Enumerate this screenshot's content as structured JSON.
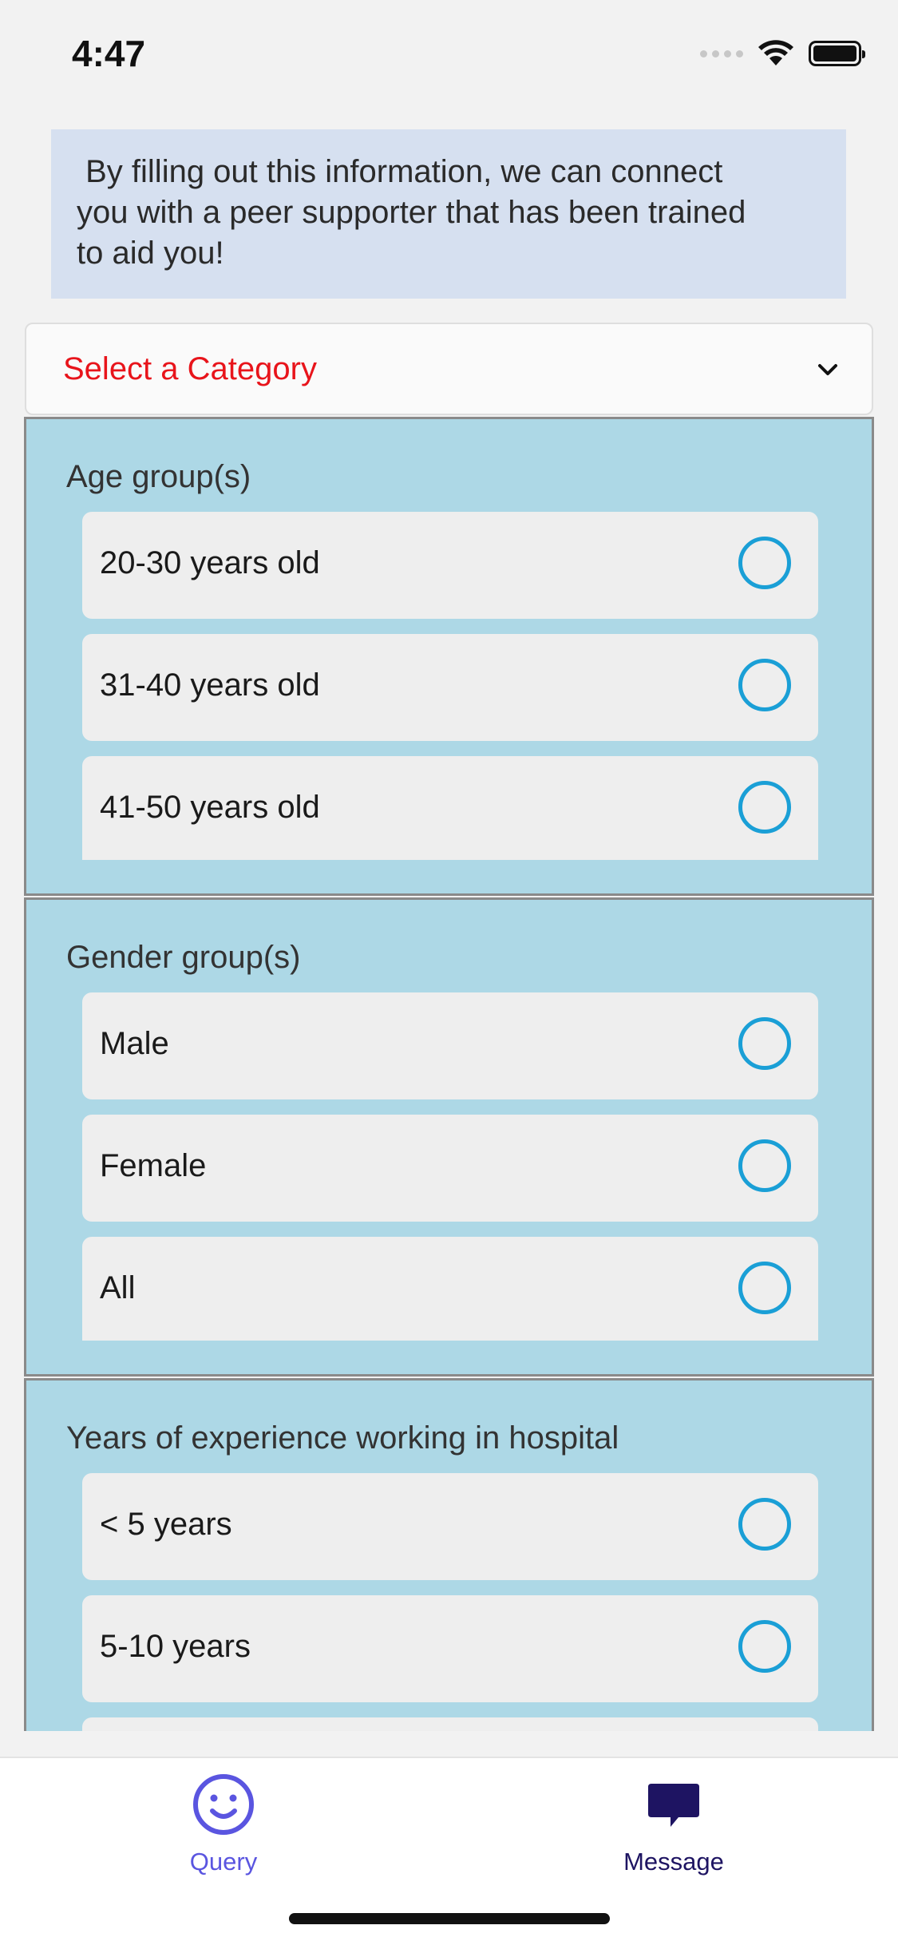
{
  "status_bar": {
    "time": "4:47"
  },
  "info_banner": {
    "text": " By filling out this information, we can connect\nyou with a peer supporter that has been trained\nto aid you!"
  },
  "category_select": {
    "placeholder": "Select a Category",
    "placeholder_color": "#e8141b",
    "icon": "chevron-down-icon"
  },
  "sections": [
    {
      "title": "Age group(s)",
      "options": [
        "20-30 years old",
        "31-40 years old",
        "41-50 years old"
      ]
    },
    {
      "title": "Gender group(s)",
      "options": [
        "Male",
        "Female",
        "All"
      ]
    },
    {
      "title": "Years of experience working in hospital",
      "options": [
        "< 5 years",
        "5-10 years"
      ]
    }
  ],
  "tab_bar": {
    "tabs": [
      {
        "label": "Query",
        "icon": "smiley-icon",
        "color": "#5a55e0"
      },
      {
        "label": "Message",
        "icon": "chat-bubble-icon",
        "color": "#1e1462"
      }
    ]
  },
  "colors": {
    "section_background": "#add8e6",
    "banner_background": "#d6e0f0",
    "radio_accent": "#1a9fd6"
  }
}
